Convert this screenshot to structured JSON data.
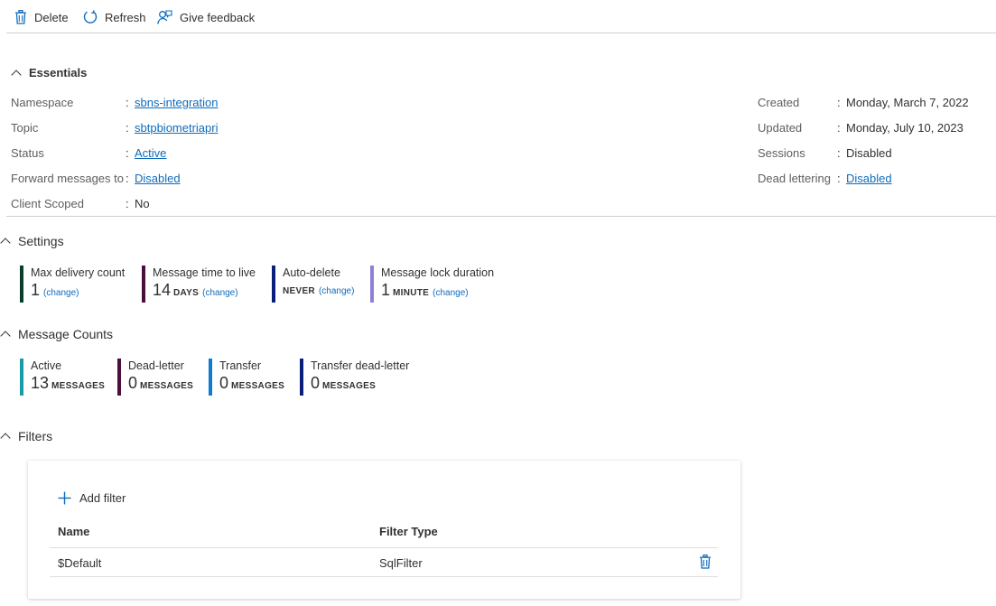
{
  "toolbar": {
    "delete_label": "Delete",
    "refresh_label": "Refresh",
    "feedback_label": "Give feedback"
  },
  "essentials": {
    "title": "Essentials",
    "left": [
      {
        "label": "Namespace",
        "value": "sbns-integration",
        "link": true
      },
      {
        "label": "Topic",
        "value": "sbtpbiometriapri",
        "link": true
      },
      {
        "label": "Status",
        "value": "Active",
        "link": true
      },
      {
        "label": "Forward messages to",
        "value": "Disabled",
        "link": true
      },
      {
        "label": "Client Scoped",
        "value": "No",
        "link": false
      }
    ],
    "right": [
      {
        "label": "Created",
        "value": "Monday, March 7, 2022",
        "link": false
      },
      {
        "label": "Updated",
        "value": "Monday, July 10, 2023",
        "link": false
      },
      {
        "label": "Sessions",
        "value": "Disabled",
        "link": false
      },
      {
        "label": "Dead lettering",
        "value": "Disabled",
        "link": true
      }
    ]
  },
  "settings": {
    "title": "Settings",
    "tiles": [
      {
        "label": "Max delivery count",
        "value": "1",
        "unit": "",
        "change": "(change)",
        "color": "#0b3d2e"
      },
      {
        "label": "Message time to live",
        "value": "14",
        "unit": "DAYS",
        "change": "(change)",
        "color": "#4b0f3b"
      },
      {
        "label": "Auto-delete",
        "value": "",
        "unit": "NEVER",
        "change": "(change)",
        "color": "#0a1f7a"
      },
      {
        "label": "Message lock duration",
        "value": "1",
        "unit": "MINUTE",
        "change": "(change)",
        "color": "#8f7fd6"
      }
    ]
  },
  "message_counts": {
    "title": "Message Counts",
    "tiles": [
      {
        "label": "Active",
        "value": "13",
        "unit": "MESSAGES",
        "color": "#1a9ba8"
      },
      {
        "label": "Dead-letter",
        "value": "0",
        "unit": "MESSAGES",
        "color": "#4b0f3b"
      },
      {
        "label": "Transfer",
        "value": "0",
        "unit": "MESSAGES",
        "color": "#0f7bd1"
      },
      {
        "label": "Transfer dead-letter",
        "value": "0",
        "unit": "MESSAGES",
        "color": "#0a1f7a"
      }
    ]
  },
  "filters": {
    "title": "Filters",
    "add_label": "Add filter",
    "columns": [
      "Name",
      "Filter Type"
    ],
    "rows": [
      {
        "name": "$Default",
        "type": "SqlFilter"
      }
    ]
  },
  "colors": {
    "accent": "#0f6cbd",
    "icon_blue": "#0f6cbd"
  }
}
